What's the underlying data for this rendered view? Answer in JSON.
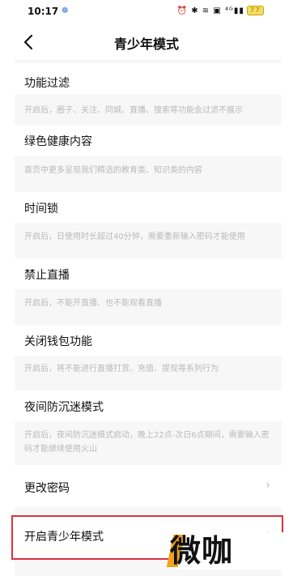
{
  "status_bar": {
    "time": "10:17",
    "app_icon": "❁",
    "system_icons": "⏰ ✱ ≋ ▣ ⁴ᴳ▮▮",
    "battery": "77"
  },
  "header": {
    "back_icon": "chevron-left-icon",
    "title": "青少年模式"
  },
  "settings": [
    {
      "label": "功能过滤",
      "description": "开启后，圈子、关注、同城、直播、搜索等功能会过滤不展示"
    },
    {
      "label": "绿色健康内容",
      "description": "首页中更多呈现我们精选的教育类、知识类的内容"
    },
    {
      "label": "时间锁",
      "description": "开启后，日使用时长超过40分钟，需要重新输入密码才能使用"
    },
    {
      "label": "禁止直播",
      "description": "开启后，不能开直播、也不能观看直播"
    },
    {
      "label": "关闭钱包功能",
      "description": "开启后，将不能进行直播打赏、充值、提现等系列行为"
    },
    {
      "label": "夜间防沉迷模式",
      "description": "开启后，夜间防沉迷模式启动，晚上22点-次日6点期间，需要输入密码才能继续使用火山"
    }
  ],
  "actions": [
    {
      "label": "更改密码",
      "chevron": "›"
    },
    {
      "label": "开启青少年模式",
      "chevron": "›"
    }
  ],
  "watermark": "微咖",
  "colors": {
    "highlight_border": "#e03040",
    "watermark_accent": "#f2a11b",
    "description_text": "#b9b9b9",
    "gap_background": "#f7f7f7"
  }
}
